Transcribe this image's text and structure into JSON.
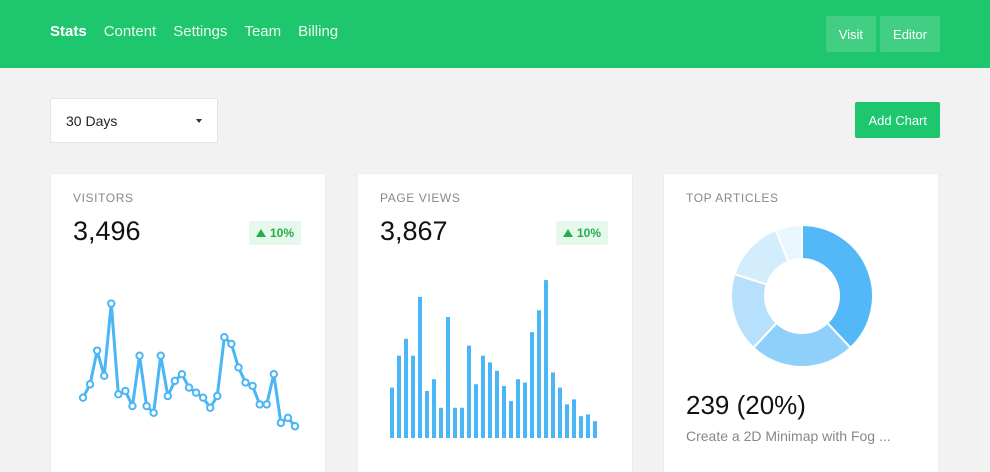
{
  "nav": {
    "items": [
      {
        "label": "Stats",
        "active": true
      },
      {
        "label": "Content",
        "active": false
      },
      {
        "label": "Settings",
        "active": false
      },
      {
        "label": "Team",
        "active": false
      },
      {
        "label": "Billing",
        "active": false
      }
    ],
    "visit_label": "Visit",
    "editor_label": "Editor"
  },
  "toolbar": {
    "range_value": "30 Days",
    "add_chart_label": "Add Chart"
  },
  "colors": {
    "brand": "#1ec66d",
    "series": "#4ab6f5",
    "badge_text": "#27ae4a"
  },
  "cards": {
    "visitors": {
      "label": "VISITORS",
      "value": "3,496",
      "change": "10%"
    },
    "page_views": {
      "label": "PAGE VIEWS",
      "value": "3,867",
      "change": "10%"
    },
    "top_articles": {
      "label": "TOP ARTICLES",
      "value": "239 (20%)",
      "subtitle": "Create a 2D Minimap with Fog ..."
    }
  },
  "chart_data": [
    {
      "type": "line",
      "x": [
        1,
        2,
        3,
        4,
        5,
        6,
        7,
        8,
        9,
        10,
        11,
        12,
        13,
        14,
        15,
        16,
        17,
        18,
        19,
        20,
        21,
        22,
        23,
        24,
        25,
        26,
        27,
        28,
        29,
        30
      ],
      "values": [
        24,
        32,
        52,
        37,
        80,
        26,
        28,
        19,
        49,
        19,
        15,
        49,
        25,
        34,
        38,
        30,
        27,
        24,
        18,
        25,
        60,
        56,
        42,
        33,
        31,
        20,
        20,
        38,
        9,
        12,
        7
      ],
      "ylim": [
        0,
        100
      ]
    },
    {
      "type": "bar",
      "values": [
        30,
        49,
        59,
        49,
        84,
        28,
        35,
        18,
        72,
        18,
        18,
        55,
        32,
        49,
        45,
        40,
        31,
        22,
        35,
        33,
        63,
        76,
        94,
        39,
        30,
        20,
        23,
        13,
        14,
        10
      ],
      "ylim": [
        0,
        100
      ]
    },
    {
      "type": "pie",
      "values": [
        38,
        24,
        18,
        14,
        6
      ],
      "colors": [
        "#52b8f7",
        "#8fd0fa",
        "#b6e0fc",
        "#d4edfd",
        "#eaf6fe"
      ]
    }
  ]
}
